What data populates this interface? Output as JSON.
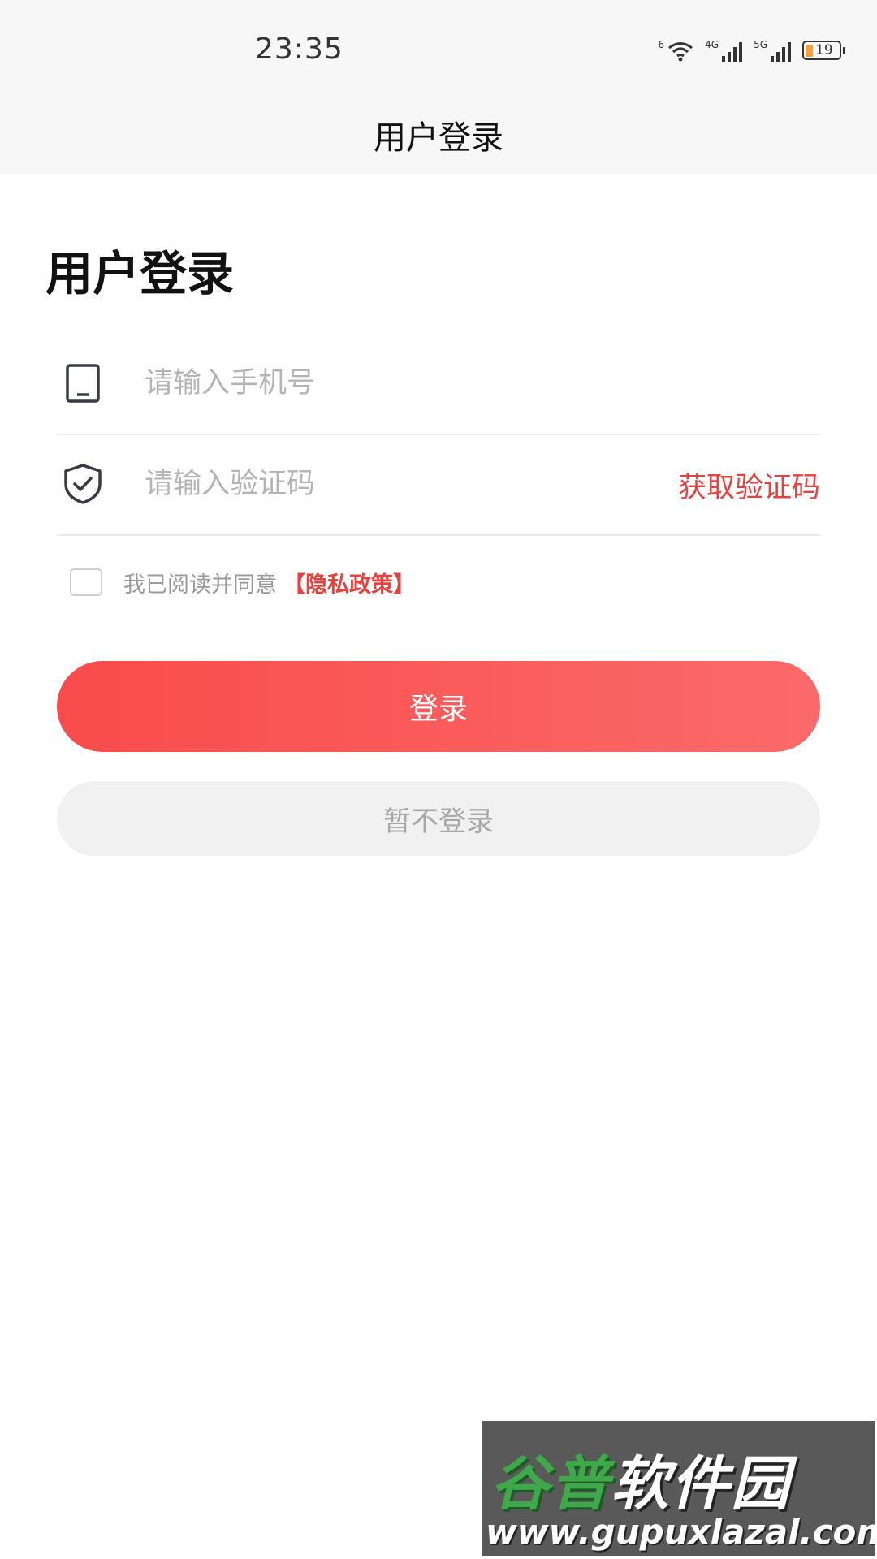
{
  "status_bar": {
    "time": "23:35",
    "wifi_tag": "6",
    "signal1_tag": "4G",
    "signal2_tag": "5G",
    "battery_level": "19",
    "battery_color": "#f2a23a"
  },
  "nav": {
    "title": "用户登录"
  },
  "heading": "用户登录",
  "phone_field": {
    "icon": "phone-icon",
    "placeholder": "请输入手机号"
  },
  "code_field": {
    "icon": "shield-check-icon",
    "placeholder": "请输入验证码",
    "get_code_label": "获取验证码"
  },
  "agreement": {
    "text": "我已阅读并同意",
    "policy_link": "【隐私政策】",
    "checked": false
  },
  "buttons": {
    "login": "登录",
    "skip": "暂不登录"
  },
  "watermark": {
    "title_green": "谷普",
    "title_white": "软件园",
    "url": "www.gupuxlazal.com"
  },
  "colors": {
    "accent": "#e8413d",
    "button_gradient_start": "#f94b4b",
    "button_gradient_end": "#fb6a6a"
  }
}
